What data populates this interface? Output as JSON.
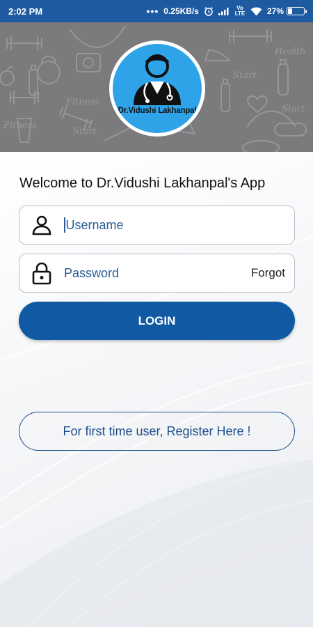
{
  "status_bar": {
    "time": "2:02 PM",
    "network_speed": "0.25KB/s",
    "volte_label": "Vo LTE",
    "battery_percent": "27%",
    "battery_level": 0.27,
    "icons": [
      "dots-icon",
      "alarm-icon",
      "signal-icon",
      "volte-icon",
      "wifi-icon",
      "battery-icon"
    ]
  },
  "header": {
    "logo_text": "Dr.Vidushi Lakhanpal",
    "banner_text": [
      "Health",
      "Fitness",
      "Start",
      "Fitness",
      "Start",
      "Start"
    ]
  },
  "login_form": {
    "welcome": "Welcome to Dr.Vidushi Lakhanpal's App",
    "username_placeholder": "Username",
    "password_placeholder": "Password",
    "forgot_label": "Forgot",
    "login_label": "LOGIN",
    "register_label": "For first time user, Register Here !"
  },
  "colors": {
    "status_bar": "#1e5aa0",
    "primary": "#0f5aa3",
    "logo_bg": "#2fa3e8",
    "banner": "#7b7b7d"
  }
}
